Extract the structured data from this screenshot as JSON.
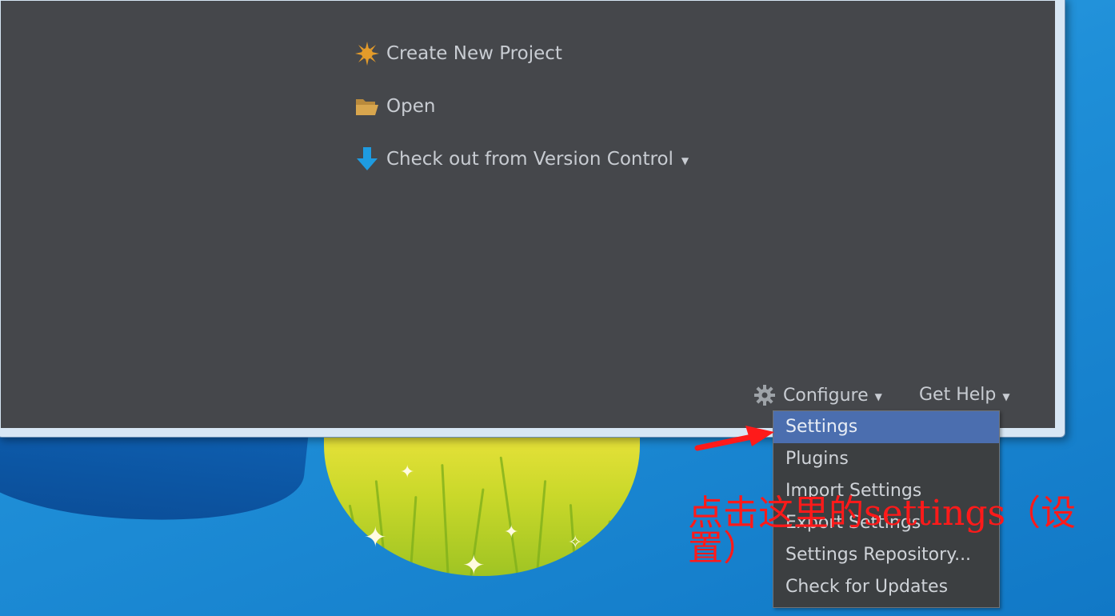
{
  "welcome": {
    "actions": [
      {
        "label": "Create New Project",
        "icon": "sunburst-icon",
        "color": "#e39b2a"
      },
      {
        "label": "Open",
        "icon": "folder-open-icon",
        "color": "#d8a64e"
      },
      {
        "label": "Check out from Version Control",
        "icon": "download-arrow-icon",
        "color": "#1e9be0"
      }
    ],
    "footer": {
      "configure_label": "Configure",
      "get_help_label": "Get Help"
    }
  },
  "configure_menu": {
    "items": [
      {
        "label": "Settings",
        "selected": true
      },
      {
        "label": "Plugins"
      },
      {
        "label": "Import Settings"
      },
      {
        "label": "Export Settings"
      },
      {
        "label": "Settings Repository..."
      },
      {
        "label": "Check for Updates"
      }
    ],
    "selected_color": "#4b6eaf"
  },
  "annotation": {
    "text": "点击这里的settings（设置）",
    "color": "#ff1a1a"
  }
}
